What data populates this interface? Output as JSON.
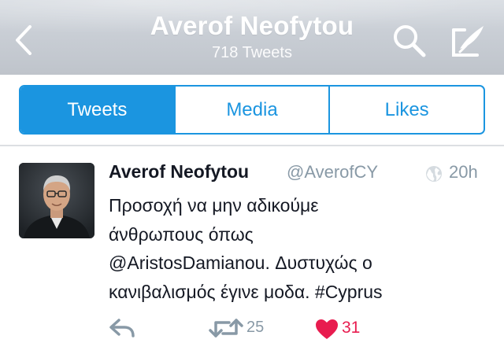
{
  "header": {
    "title": "Averof Neofytou",
    "subtitle": "718 Tweets",
    "back_icon": "chevron-left-icon",
    "search_icon": "search-icon",
    "compose_icon": "compose-icon"
  },
  "tabs": [
    {
      "label": "Tweets",
      "active": true
    },
    {
      "label": "Media",
      "active": false
    },
    {
      "label": "Likes",
      "active": false
    }
  ],
  "tweet": {
    "name": "Averof Neofytou",
    "handle": "@AverofCY",
    "time": "20h",
    "globe_icon": "globe-icon",
    "lines": [
      "Προσοχή να μην αδικούμε",
      "άνθρωπους όπως",
      "@AristosDamianou. Δυστυχώς ο",
      "κανιβαλισμός έγινε μοδα. #Cyprus"
    ],
    "retweet_count": "25",
    "like_count": "31"
  },
  "colors": {
    "accent": "#1b95e0",
    "like": "#e81c4f",
    "muted": "#8899a6",
    "text": "#141823"
  }
}
